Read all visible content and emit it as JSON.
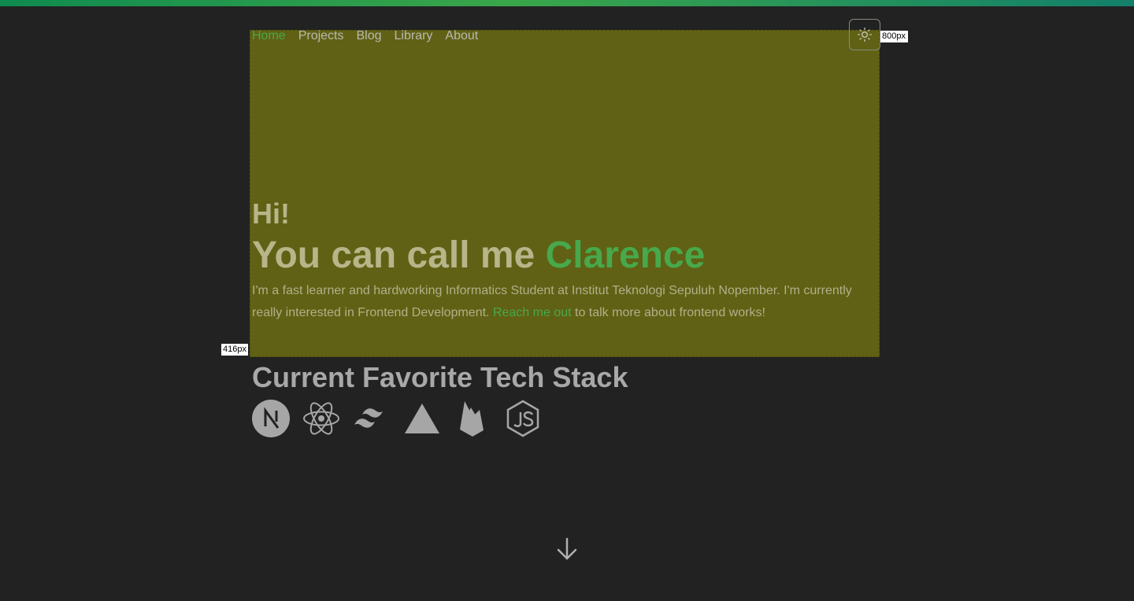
{
  "nav": {
    "items": [
      {
        "label": "Home"
      },
      {
        "label": "Projects"
      },
      {
        "label": "Blog"
      },
      {
        "label": "Library"
      },
      {
        "label": "About"
      }
    ]
  },
  "devtools": {
    "width_label": "800px",
    "height_label": "416px"
  },
  "hero": {
    "greeting": "Hi!",
    "headline_prefix": "You can call me ",
    "headline_name": "Clarence",
    "intro_part1": "I'm a fast learner and hardworking Informatics Student at Institut Teknologi Sepuluh Nopember. I'm currently really interested in Frontend Development. ",
    "intro_link": "Reach me out",
    "intro_part2": " to talk more about frontend works!"
  },
  "tech_stack": {
    "title": "Current Favorite Tech Stack",
    "icons": [
      "nextjs-icon",
      "react-icon",
      "tailwindcss-icon",
      "vercel-icon",
      "firebase-icon",
      "nodejs-icon"
    ]
  },
  "icons": {
    "theme_toggle": "sun-icon",
    "scroll": "arrow-down-icon"
  },
  "colors": {
    "accent": "#48a84b",
    "background": "#222222",
    "overlay": "#606114"
  }
}
